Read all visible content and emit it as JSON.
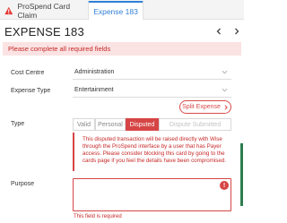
{
  "tabs": {
    "claim_label": "ProSpend Card Claim",
    "expense_label": "Expense 183"
  },
  "header": {
    "title": "EXPENSE 183"
  },
  "alert": {
    "message": "Please complete all required fields"
  },
  "form": {
    "cost_centre": {
      "label": "Cost Centre",
      "value": "Administration"
    },
    "expense_type": {
      "label": "Expense Type",
      "value": "Entertainment"
    },
    "split_expense_label": "Split Expense",
    "type": {
      "label": "Type",
      "options": [
        "Valid",
        "Personal",
        "Disputed",
        "Dispute Submitted"
      ],
      "selected": "Disputed"
    },
    "dispute_notice": "This disputed transaction will be raised directly with Wise through the ProSpend interface by a user that has Payer access. Please consider blocking this card by going to the cards page if you feel the details have been compromised.",
    "purpose": {
      "label": "Purpose",
      "value": "",
      "error": "This field is required"
    }
  },
  "colors": {
    "accent_blue": "#2f7fd7",
    "error_red": "#d64545",
    "alert_bg": "#fbe3e3"
  },
  "icons": {
    "claim_tab": "warning-triangle-icon",
    "prev": "chevron-left-icon",
    "next": "chevron-right-icon",
    "dropdown": "chevron-down-icon",
    "split": "chevron-right-icon",
    "field_error": "exclamation-circle-icon"
  }
}
